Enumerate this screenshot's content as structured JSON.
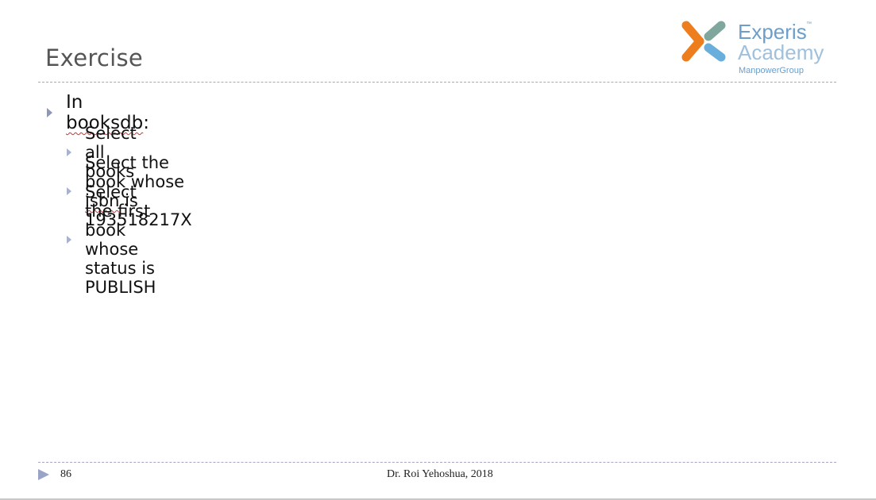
{
  "slide": {
    "title": "Exercise",
    "logo": {
      "word1": "Experis",
      "tm": "™",
      "word2": "Academy",
      "sub": "ManpowerGroup",
      "colors": {
        "orange": "#ee7d1e",
        "teal": "#7fa79e",
        "blue": "#6aaedb",
        "text": "#6c9ec9"
      }
    },
    "bullets": {
      "level1": {
        "prefix": "In ",
        "flagged": "booksdb",
        "suffix": ":"
      },
      "level2": [
        {
          "before": "Select all books",
          "flagged": "",
          "after": ""
        },
        {
          "before": "Select the book whose ",
          "flagged": "isbn",
          "after": " is 193518217X"
        },
        {
          "before": "Select the first book whose status is PUBLISH",
          "flagged": "",
          "after": ""
        }
      ]
    },
    "footer": {
      "page_number": "86",
      "author": "Dr. Roi Yehoshua, 2018"
    }
  }
}
